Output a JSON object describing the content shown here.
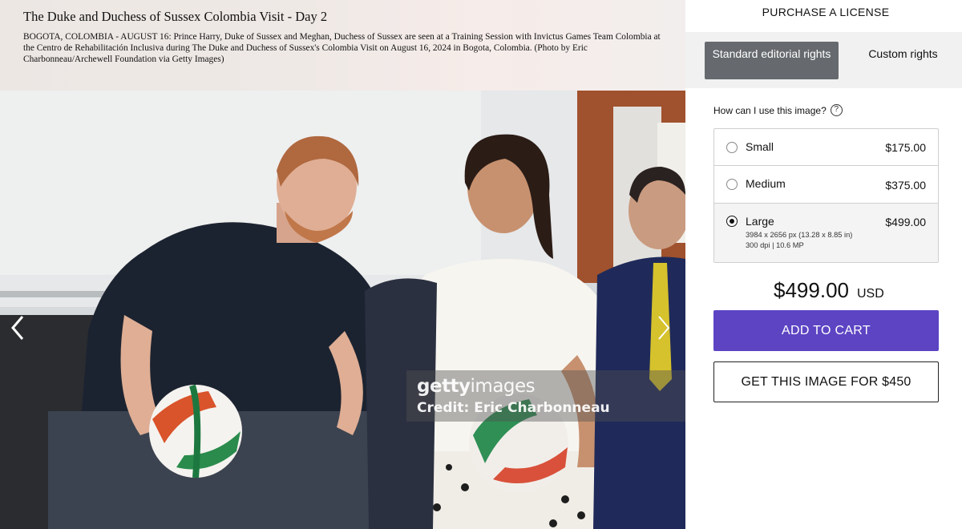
{
  "image": {
    "title": "The Duke and Duchess of Sussex Colombia Visit - Day 2",
    "caption": "BOGOTA, COLOMBIA - AUGUST 16: Prince Harry, Duke of Sussex and Meghan, Duchess of Sussex are seen at a Training Session with Invictus Games Team Colombia at the Centro de Rehabilitación Inclusiva during The Duke and Duchess of Sussex's Colombia Visit on August 16, 2024 in Bogota, Colombia. (Photo by Eric Charbonneau/Archewell Foundation via Getty Images)",
    "watermark_brand_bold": "getty",
    "watermark_brand_light": "images",
    "watermark_credit": "Credit: Eric Charbonneau",
    "prev_icon": "chevron-left-icon",
    "next_icon": "chevron-right-icon"
  },
  "purchase": {
    "heading": "PURCHASE A LICENSE",
    "tabs": [
      {
        "label": "Standard editorial rights",
        "selected": true
      },
      {
        "label": "Custom rights",
        "selected": false
      }
    ],
    "usage_question": "How can I use this image?",
    "help_icon": "question-circle-icon",
    "sizes": [
      {
        "name": "Small",
        "price": "$175.00",
        "selected": false,
        "detail_line1": "",
        "detail_line2": ""
      },
      {
        "name": "Medium",
        "price": "$375.00",
        "selected": false,
        "detail_line1": "",
        "detail_line2": ""
      },
      {
        "name": "Large",
        "price": "$499.00",
        "selected": true,
        "detail_line1": "3984 x 2656 px (13.28 x 8.85 in)",
        "detail_line2": "300 dpi | 10.6 MP"
      }
    ],
    "total_amount": "$499.00",
    "total_currency": "USD",
    "add_to_cart_label": "ADD TO CART",
    "offer_label": "GET THIS IMAGE FOR $450"
  },
  "colors": {
    "accent_purple": "#5c44c3",
    "selected_tab_gray": "#666a6e"
  }
}
